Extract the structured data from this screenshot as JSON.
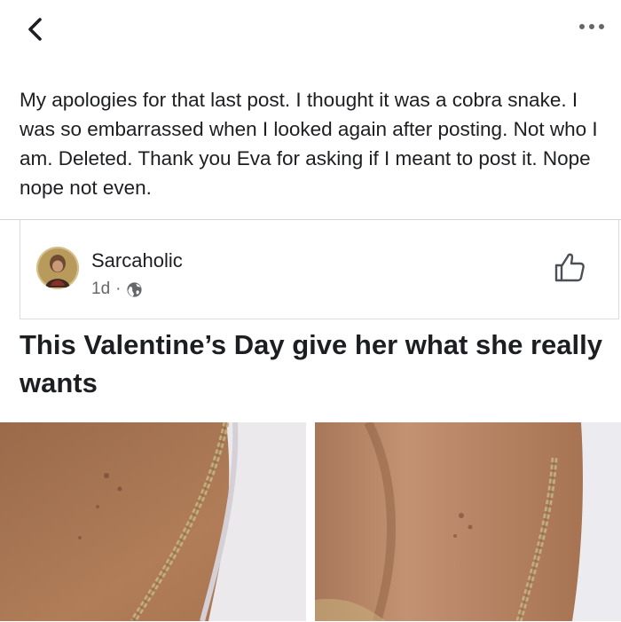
{
  "post": {
    "caption": "My apologies for that last post. I thought it was a cobra snake. I was so embarrassed when I looked again after posting. Not who I am. Deleted. Thank you Eva for asking if I meant to post it. Nope nope not even."
  },
  "shared": {
    "author": "Sarcaholic",
    "time": "1d",
    "separator": "·",
    "headline": "This Valentine’s Day give her what she really wants"
  },
  "icons": {
    "back": "chevron-left-icon",
    "more": "more-horizontal-icon",
    "privacy": "globe-icon",
    "like": "thumbs-up-icon"
  },
  "colors": {
    "text": "#1c1e21",
    "meta": "#65676b",
    "divider": "#dcdcdc"
  }
}
